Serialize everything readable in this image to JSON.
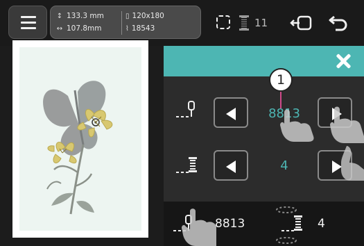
{
  "topbar": {
    "height_value": "133.3 mm",
    "width_value": "107.8mm",
    "hoop_size": "120x180",
    "stitch_count": "18543",
    "color_count": "11",
    "icons": [
      "menu-icon",
      "height-icon",
      "width-icon",
      "hoop-icon",
      "stitch-icon",
      "selection-icon",
      "bobbin-icon",
      "exit-icon",
      "back-icon"
    ]
  },
  "panel": {
    "accent_color": "#4db6b3",
    "rows": [
      {
        "name": "thread-color",
        "icon": "needle-thread-icon",
        "value": "8813"
      },
      {
        "name": "bobbin-color",
        "icon": "bobbin-icon",
        "value": "4"
      }
    ],
    "bottom": {
      "thread_value": "8813",
      "bobbin_value": "4"
    }
  },
  "callout": {
    "number": "1",
    "line_color": "#d04a8a"
  }
}
